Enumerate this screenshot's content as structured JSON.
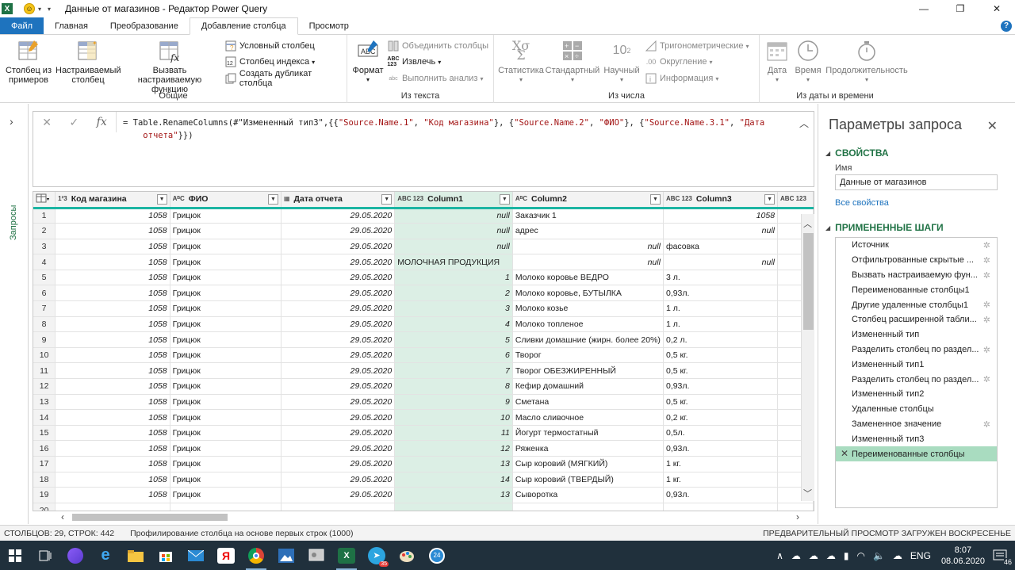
{
  "window": {
    "title": "Данные от магазинов - Редактор Power Query",
    "minimize": "—",
    "maximize": "❐",
    "close": "✕"
  },
  "menu": {
    "tabs": [
      {
        "label": "Файл"
      },
      {
        "label": "Главная"
      },
      {
        "label": "Преобразование"
      },
      {
        "label": "Добавление столбца"
      },
      {
        "label": "Просмотр"
      }
    ],
    "help": "?"
  },
  "ribbon": {
    "general": {
      "label": "Общие",
      "col_from_examples": "Столбец из примеров",
      "custom_col": "Настраиваемый столбец",
      "invoke_custom_func": "Вызвать настраиваемую функцию",
      "conditional_col": "Условный столбец",
      "index_col": "Столбец индекса",
      "duplicate_col": "Создать дубликат столбца"
    },
    "text": {
      "label": "Из текста",
      "format": "Формат",
      "merge_cols": "Объединить столбцы",
      "extract": "Извлечь",
      "parse": "Выполнить анализ"
    },
    "number": {
      "label": "Из числа",
      "statistics": "Статистика",
      "standard": "Стандартный",
      "scientific": "Научный",
      "trig": "Тригонометрические",
      "rounding": "Округление",
      "information": "Информация"
    },
    "datetime": {
      "label": "Из даты и времени",
      "date": "Дата",
      "time": "Время",
      "duration": "Продолжительность"
    }
  },
  "left_pane": {
    "label": "Запросы"
  },
  "formula": {
    "line1_prefix": "= Table.RenameColumns(#\"Измененный тип3\",{{",
    "line1_s1": "\"Source.Name.1\"",
    "line1_c1": ", ",
    "line1_s2": "\"Код магазина\"",
    "line1_c2": "}, {",
    "line1_s3": "\"Source.Name.2\"",
    "line1_c3": ", ",
    "line1_s4": "\"ФИО\"",
    "line1_c4": "}, {",
    "line1_s5": "\"Source.Name.3.1\"",
    "line1_c5": ", ",
    "line1_s6": "\"Дата",
    "line2_s": "    отчета\"",
    "line2_end": "}})"
  },
  "grid": {
    "columns": [
      {
        "type": "1²3",
        "name": "Код магазина"
      },
      {
        "type": "AᴮC",
        "name": "ФИО"
      },
      {
        "type": "▦",
        "name": "Дата отчета"
      },
      {
        "type": "ABC 123",
        "name": "Column1"
      },
      {
        "type": "AᴮC",
        "name": "Column2"
      },
      {
        "type": "ABC 123",
        "name": "Column3"
      },
      {
        "type": "ABC 123",
        "name": ""
      }
    ],
    "rows": [
      [
        "1",
        "1058",
        "Грицюк",
        "29.05.2020",
        "null",
        "Заказчик 1",
        "1058"
      ],
      [
        "2",
        "1058",
        "Грицюк",
        "29.05.2020",
        "null",
        "адрес",
        "null"
      ],
      [
        "3",
        "1058",
        "Грицюк",
        "29.05.2020",
        "null",
        "null",
        "фасовка"
      ],
      [
        "4",
        "1058",
        "Грицюк",
        "29.05.2020",
        "МОЛОЧНАЯ ПРОДУКЦИЯ",
        "null",
        "null"
      ],
      [
        "5",
        "1058",
        "Грицюк",
        "29.05.2020",
        "1",
        "Молоко коровье  ВЕДРО",
        "3 л."
      ],
      [
        "6",
        "1058",
        "Грицюк",
        "29.05.2020",
        "2",
        "Молоко коровье, БУТЫЛКА",
        "0,93л."
      ],
      [
        "7",
        "1058",
        "Грицюк",
        "29.05.2020",
        "3",
        "Молоко козье",
        "1 л."
      ],
      [
        "8",
        "1058",
        "Грицюк",
        "29.05.2020",
        "4",
        "Молоко топленое",
        "1 л."
      ],
      [
        "9",
        "1058",
        "Грицюк",
        "29.05.2020",
        "5",
        "Сливки домашние (жирн. более 20%)",
        "0,2 л."
      ],
      [
        "10",
        "1058",
        "Грицюк",
        "29.05.2020",
        "6",
        "Творог",
        "0,5 кг."
      ],
      [
        "11",
        "1058",
        "Грицюк",
        "29.05.2020",
        "7",
        "Творог ОБЕЗЖИРЕННЫЙ",
        "0,5 кг."
      ],
      [
        "12",
        "1058",
        "Грицюк",
        "29.05.2020",
        "8",
        "Кефир домашний",
        "0,93л."
      ],
      [
        "13",
        "1058",
        "Грицюк",
        "29.05.2020",
        "9",
        "Сметана",
        "0,5 кг."
      ],
      [
        "14",
        "1058",
        "Грицюк",
        "29.05.2020",
        "10",
        "Масло сливочное",
        "0,2 кг."
      ],
      [
        "15",
        "1058",
        "Грицюк",
        "29.05.2020",
        "11",
        "Йогурт термостатный",
        "0,5л."
      ],
      [
        "16",
        "1058",
        "Грицюк",
        "29.05.2020",
        "12",
        "Ряженка",
        "0,93л."
      ],
      [
        "17",
        "1058",
        "Грицюк",
        "29.05.2020",
        "13",
        "Сыр коровий (МЯГКИЙ)",
        "1 кг."
      ],
      [
        "18",
        "1058",
        "Грицюк",
        "29.05.2020",
        "14",
        "Сыр коровий (ТВЕРДЫЙ)",
        "1 кг."
      ],
      [
        "19",
        "1058",
        "Грицюк",
        "29.05.2020",
        "13",
        "Сыворотка",
        "0,93л."
      ],
      [
        "20",
        "",
        "",
        "",
        "",
        "",
        ""
      ]
    ]
  },
  "right_pane": {
    "title": "Параметры запроса",
    "properties_header": "СВОЙСТВА",
    "name_label": "Имя",
    "name_value": "Данные от магазинов",
    "all_properties": "Все свойства",
    "steps_header": "ПРИМЕНЕННЫЕ ШАГИ",
    "steps": [
      {
        "label": "Источник",
        "gear": true
      },
      {
        "label": "Отфильтрованные скрытые ...",
        "gear": true
      },
      {
        "label": "Вызвать настраиваемую фун...",
        "gear": true
      },
      {
        "label": "Переименованные столбцы1",
        "gear": false
      },
      {
        "label": "Другие удаленные столбцы1",
        "gear": true
      },
      {
        "label": "Столбец расширенной табли...",
        "gear": true
      },
      {
        "label": "Измененный тип",
        "gear": false
      },
      {
        "label": "Разделить столбец по раздел...",
        "gear": true
      },
      {
        "label": "Измененный тип1",
        "gear": false
      },
      {
        "label": "Разделить столбец по раздел...",
        "gear": true
      },
      {
        "label": "Измененный тип2",
        "gear": false
      },
      {
        "label": "Удаленные столбцы",
        "gear": false
      },
      {
        "label": "Замененное значение",
        "gear": true
      },
      {
        "label": "Измененный тип3",
        "gear": false
      },
      {
        "label": "Переименованные столбцы",
        "gear": false,
        "active": true
      }
    ]
  },
  "status": {
    "counts": "СТОЛБЦОВ: 29, СТРОК: 442",
    "profiling": "Профилирование столбца на основе первых строк (1000)",
    "preview": "ПРЕДВАРИТЕЛЬНЫЙ ПРОСМОТР ЗАГРУЖЕН ВОСКРЕСЕНЬЕ"
  },
  "taskbar": {
    "lang": "ENG",
    "time": "8:07",
    "date": "08.06.2020",
    "notifications": "46",
    "telegram_badge": "35",
    "circle_badge": "24"
  },
  "colors": {
    "accent_green": "#217346",
    "file_tab": "#1e73be",
    "selected_column": "#dcefe5",
    "active_step": "#a9dcc0",
    "taskbar": "#20303c"
  }
}
